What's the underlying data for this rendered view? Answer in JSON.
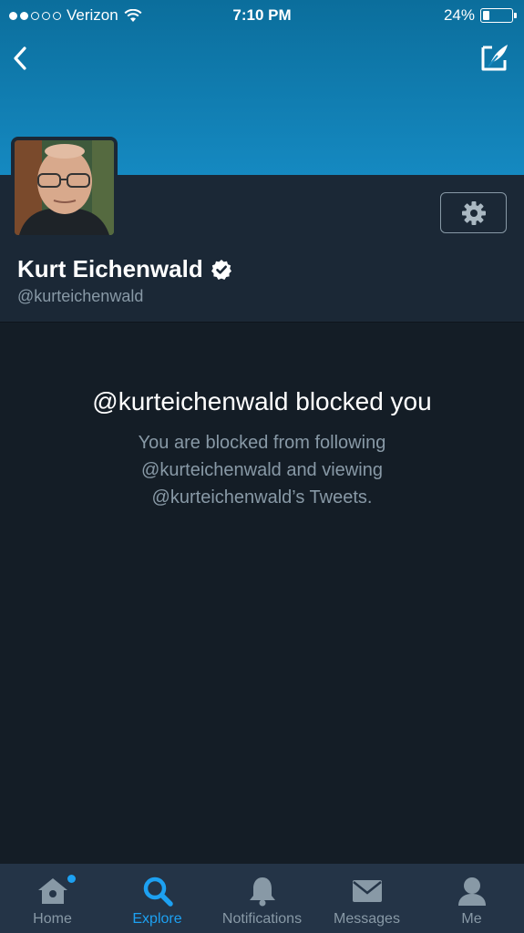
{
  "status_bar": {
    "carrier": "Verizon",
    "time": "7:10 PM",
    "battery_percent": "24%",
    "battery_level": 0.24,
    "signal_bars_filled": 2,
    "signal_bars_total": 5
  },
  "header": {
    "back_icon": "chevron-left-icon",
    "compose_icon": "compose-icon"
  },
  "profile": {
    "display_name": "Kurt Eichenwald",
    "handle": "@kurteichenwald",
    "verified": true,
    "settings_icon": "gear-icon"
  },
  "blocked": {
    "title": "@kurteichenwald blocked you",
    "line1": "You are blocked from following",
    "line2": "@kurteichenwald and viewing",
    "line3": "@kurteichenwald’s Tweets."
  },
  "tabbar": {
    "home": "Home",
    "explore": "Explore",
    "notifications": "Notifications",
    "messages": "Messages",
    "me": "Me",
    "active": "explore"
  },
  "colors": {
    "accent": "#1da1f2",
    "header_blue": "#1589c1",
    "background": "#141d26",
    "muted_text": "#8899a6"
  }
}
